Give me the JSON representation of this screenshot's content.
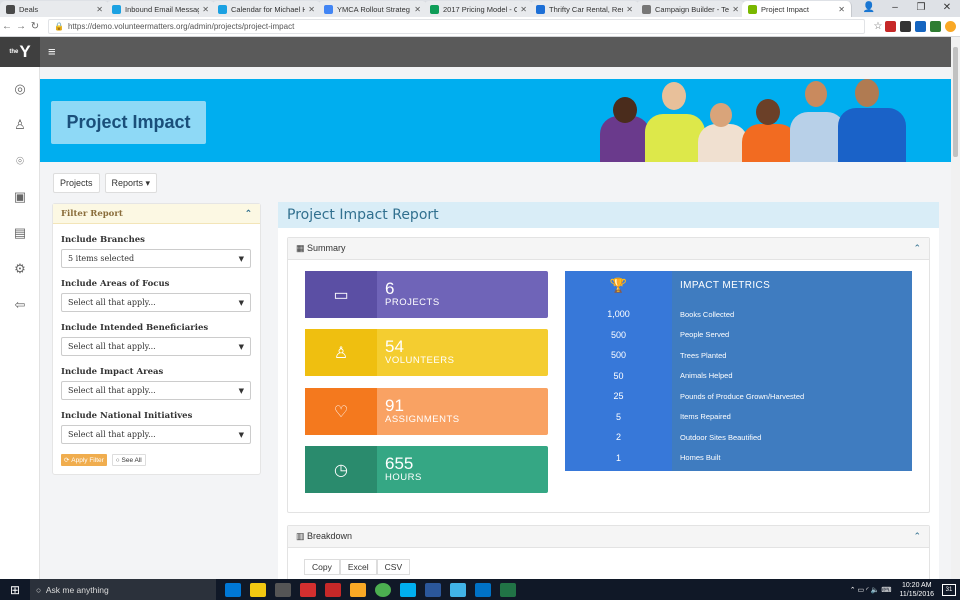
{
  "browser": {
    "tabs": [
      {
        "title": "Deals",
        "color": "#4a4a4a"
      },
      {
        "title": "Inbound Email Messag",
        "color": "#1ba1e2"
      },
      {
        "title": "Calendar for Michael H",
        "color": "#1ba1e2"
      },
      {
        "title": "YMCA Rollout Strateg",
        "color": "#4285f4"
      },
      {
        "title": "2017 Pricing Model - G",
        "color": "#0f9d58"
      },
      {
        "title": "Thrifty Car Rental, Ren",
        "color": "#1d6fd6"
      },
      {
        "title": "Campaign Builder - Te",
        "color": "#777777"
      },
      {
        "title": "Project Impact",
        "color": "#7ab800"
      }
    ],
    "url": "https://demo.volunteermatters.org/admin/projects/project-impact"
  },
  "topbar": {
    "logo_small": "the",
    "logo": "Y",
    "menu_icon": "≡"
  },
  "banner": {
    "title": "Project Impact"
  },
  "subnav": {
    "projects": "Projects",
    "reports": "Reports ▾"
  },
  "filter": {
    "title": "Filter Report",
    "groups": [
      {
        "label": "Include Branches",
        "value": "5 items selected"
      },
      {
        "label": "Include Areas of Focus",
        "value": "Select all that apply..."
      },
      {
        "label": "Include Intended Beneficiaries",
        "value": "Select all that apply..."
      },
      {
        "label": "Include Impact Areas",
        "value": "Select all that apply..."
      },
      {
        "label": "Include National Initiatives",
        "value": "Select all that apply..."
      }
    ],
    "apply": "Apply Filter",
    "see_all": "See All"
  },
  "report": {
    "title": "Project Impact Report",
    "summary_title": "Summary",
    "stats": [
      {
        "value": "6",
        "label": "PROJECTS",
        "color": "#6f64b8",
        "iconcolor": "#5b4fa4"
      },
      {
        "value": "54",
        "label": "VOLUNTEERS",
        "color": "#f4cd30",
        "iconcolor": "#efbf10"
      },
      {
        "value": "91",
        "label": "ASSIGNMENTS",
        "color": "#f9a263",
        "iconcolor": "#f4791e"
      },
      {
        "value": "655",
        "label": "HOURS",
        "color": "#35a784",
        "iconcolor": "#2a8b6d"
      }
    ],
    "metrics_title": "IMPACT METRICS",
    "metrics": [
      {
        "value": "1,000",
        "label": "Books Collected"
      },
      {
        "value": "500",
        "label": "People Served"
      },
      {
        "value": "500",
        "label": "Trees Planted"
      },
      {
        "value": "50",
        "label": "Animals Helped"
      },
      {
        "value": "25",
        "label": "Pounds of Produce Grown/Harvested"
      },
      {
        "value": "5",
        "label": "Items Repaired"
      },
      {
        "value": "2",
        "label": "Outdoor Sites Beautified"
      },
      {
        "value": "1",
        "label": "Homes Built"
      }
    ],
    "breakdown_title": "Breakdown",
    "exports": [
      "Copy",
      "Excel",
      "CSV"
    ]
  },
  "taskbar": {
    "search": "Ask me anything",
    "time": "10:20 AM",
    "date": "11/15/2016",
    "notif": "31"
  }
}
